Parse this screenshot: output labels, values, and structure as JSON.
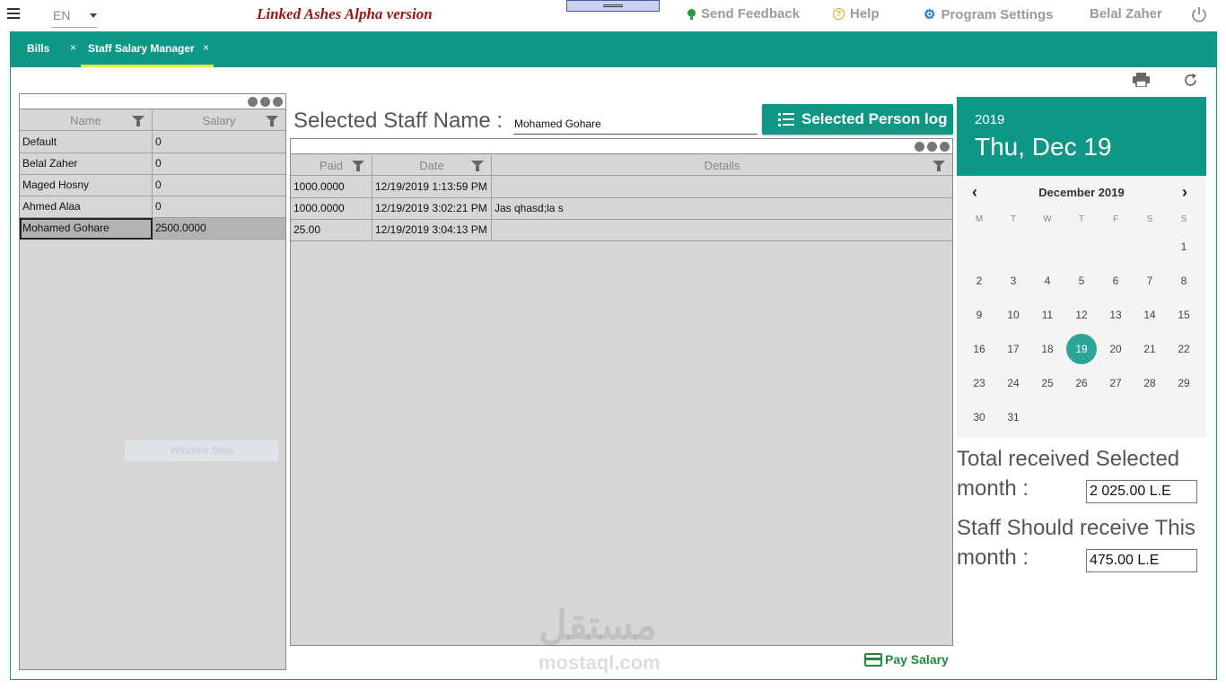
{
  "topbar": {
    "language": "EN",
    "app_title": "Linked Ashes Alpha version",
    "send_feedback": "Send Feedback",
    "help": "Help",
    "program_settings": "Program Settings",
    "user_name": "Belal Zaher"
  },
  "tabs": [
    {
      "label": "Bills",
      "close": "×"
    },
    {
      "label": "Staff Salary Manager",
      "close": "×",
      "active": true
    }
  ],
  "staff_grid": {
    "columns": [
      "Name",
      "Salary"
    ],
    "rows": [
      {
        "name": "Default",
        "salary": "0"
      },
      {
        "name": "Belal Zaher",
        "salary": "0"
      },
      {
        "name": "Maged Hosny",
        "salary": "0"
      },
      {
        "name": "Ahmed Alaa",
        "salary": "0"
      },
      {
        "name": "Mohamed Gohare",
        "salary": "2500.0000"
      }
    ],
    "selected_row": 4
  },
  "selected_staff": {
    "label": "Selected Staff Name :",
    "value": "Mohamed Gohare",
    "log_button": "Selected Person log"
  },
  "payments_grid": {
    "columns": [
      "Paid",
      "Date",
      "Details"
    ],
    "rows": [
      {
        "paid": "1000.0000",
        "date": "12/19/2019 1:13:59 PM",
        "details": ""
      },
      {
        "paid": "1000.0000",
        "date": "12/19/2019 3:02:21 PM",
        "details": "Jas qhasd;la s"
      },
      {
        "paid": "25.00",
        "date": "12/19/2019 3:04:13 PM",
        "details": ""
      }
    ]
  },
  "calendar": {
    "year": "2019",
    "date_header": "Thu, Dec 19",
    "month_label": "December 2019",
    "weekdays": [
      "M",
      "T",
      "W",
      "T",
      "F",
      "S",
      "S"
    ],
    "first_weekday_index": 6,
    "days_in_month": 31,
    "selected_day": 19,
    "accent": "#0f9785"
  },
  "totals": {
    "received_label_1": "Total received Selected",
    "received_label_2": "month :",
    "received_value": "2 025.00 L.E",
    "should_label_1": "Staff Should receive This",
    "should_label_2": "month :",
    "should_value": "475.00 L.E"
  },
  "pay_button": "Pay Salary",
  "overlay": {
    "window_snip": "Window Snip",
    "watermark_arabic": "مستقل",
    "watermark_latin": "mostaql.com"
  },
  "colors": {
    "teal": "#0f9785",
    "title_red": "#9b1414",
    "pay_green": "#1e8a3e"
  }
}
